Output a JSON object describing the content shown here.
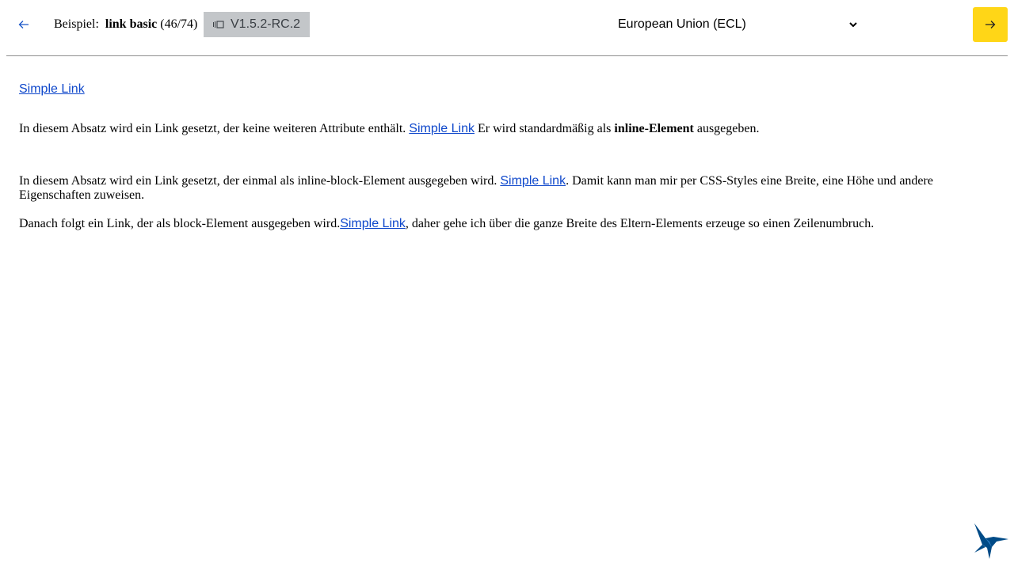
{
  "header": {
    "example_prefix": "Beispiel:",
    "example_name": "link basic",
    "example_count": "(46/74)",
    "version": "V1.5.2-RC.2",
    "theme_selected": "European Union (ECL)"
  },
  "content": {
    "top_link": "Simple Link",
    "p1_before": "In diesem Absatz wird ein Link gesetzt, der keine weiteren Attribute enthält.",
    "p1_link": "Simple Link",
    "p1_after": "Er wird standardmäßig als",
    "p1_bold": "inline-Element",
    "p1_end": "ausgegeben.",
    "p2_before": "In diesem Absatz wird ein Link gesetzt, der einmal als inline-block-Element ausgegeben wird.",
    "p2_link": "Simple Link",
    "p2_after": ". Damit kann man mir per CSS-Styles eine Breite, eine Höhe und andere Eigenschaften zuweisen.",
    "p3_before": "Danach folgt ein Link, der als block-Element ausgegeben wird.",
    "p3_link": "Simple Link",
    "p3_after": ", daher gehe ich über die ganze Breite des Eltern-Elements erzeuge so einen Zeilenumbruch."
  },
  "icons": {
    "back": "arrow-left-icon",
    "next": "arrow-right-icon",
    "version": "version-icon",
    "dropdown": "chevron-down-icon",
    "logo": "hummingbird-logo"
  },
  "colors": {
    "accent_yellow": "#ffd617",
    "link_blue": "#0e47cb",
    "badge_grey": "#c3c6c9",
    "logo_blue": "#004b87"
  }
}
